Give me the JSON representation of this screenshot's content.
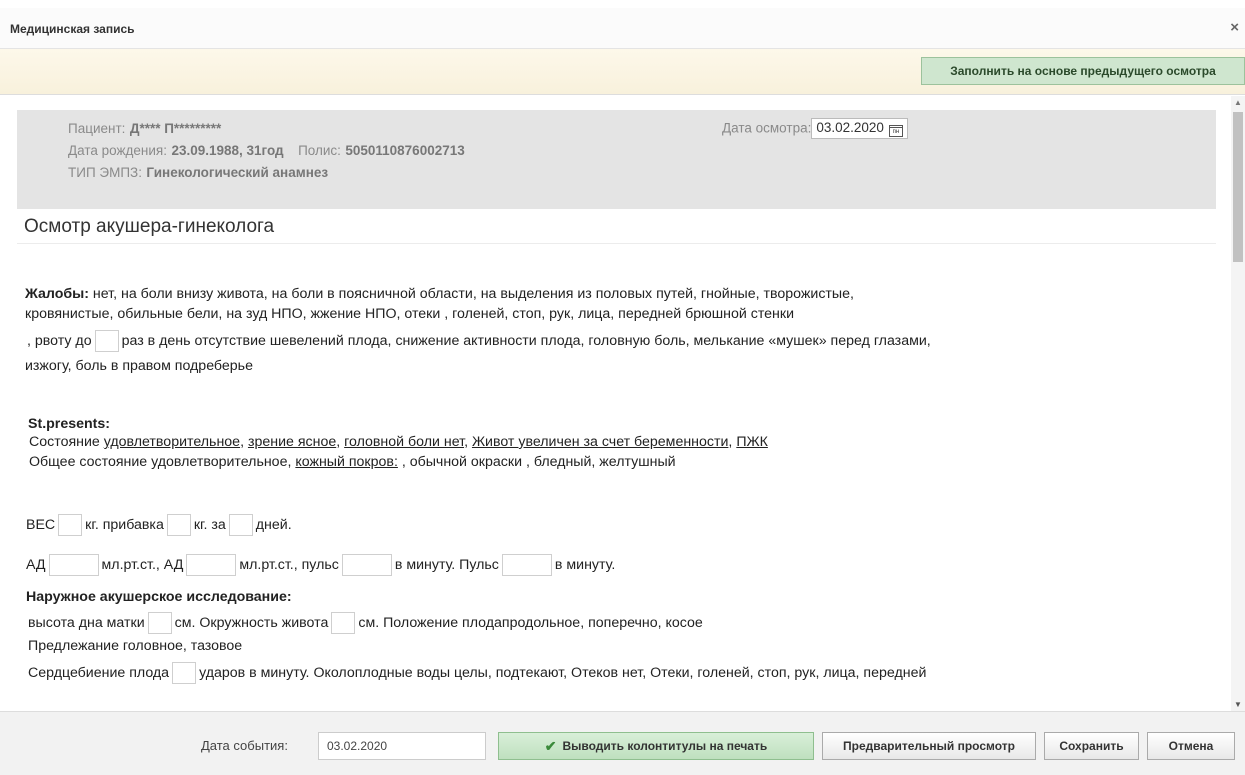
{
  "window": {
    "title": "Медицинская запись",
    "close_symbol": "×"
  },
  "toolbar": {
    "fill_button": "Заполнить на основе предыдущего осмотра"
  },
  "patient": {
    "patient_label": "Пациент:",
    "patient_name": "Д**** П*********",
    "birth_label": "Дата рождения:",
    "birth_value": "23.09.1988, 31год",
    "policy_label": "Полис:",
    "policy_value": "5050110876002713",
    "type_label": "ТИП ЭМПЗ:",
    "type_value": "Гинекологический анамнез",
    "exam_date_label": "Дата осмотра:",
    "exam_date_value": "03.02.2020",
    "calendar_icon_text": "пн"
  },
  "form": {
    "title": "Осмотр акушера-гинеколога",
    "complaints_label": "Жалобы:",
    "complaints_l1": " нет, на боли внизу живота, на боли в поясничной области, на выделения из половых путей, гнойные, творожистые,",
    "complaints_l2": "кровянистые, обильные бели, на зуд НПО, жжение НПО, отеки , голеней, стоп, рук, лица, передней брюшной стенки",
    "complaints_l3a": ", рвоту до",
    "complaints_l3b": "раз в день",
    "complaints_l3c": "отсутствие шевелений плода, снижение активности плода, головную боль, мелькание «мушек» перед глазами,",
    "complaints_l4": "изжогу, боль в правом подреберье",
    "st_label": "St.presents:",
    "st1_a": "Состояние ",
    "st1_b": "удовлетворительное",
    "st1_c": ", ",
    "st1_d": "зрение ясное",
    "st1_e": ", ",
    "st1_f": "головной боли нет",
    "st1_g": ", ",
    "st1_h": "Живот увеличен за счет беременности",
    "st1_i": ", ",
    "st1_j": "ПЖК",
    "st2_a": "Общее состояние удовлетворительное, ",
    "st2_b": "кожный покров:",
    "st2_c": " , обычной окраски , бледный, желтушный",
    "weight_a": "ВЕС",
    "weight_b": "кг. прибавка",
    "weight_c": "кг. за",
    "weight_d": "дней.",
    "bp_a": "АД",
    "bp_b": "мл.рт.ст., АД",
    "bp_c": "мл.рт.ст., пульс",
    "bp_d": "в минуту. Пульс",
    "bp_e": "в минуту.",
    "ext_label": "Наружное акушерское исследование:",
    "ext1_a": "высота дна матки",
    "ext1_b": "см. Окружность живота",
    "ext1_c": "см.",
    "ext1_d": "Положение плодапродольное, поперечно, косое",
    "ext2": "Предлежание головное, тазовое",
    "ext3_a": "Сердцебиение плода",
    "ext3_b": "ударов в минуту.",
    "ext3_c": "Околоплодные воды целы, подтекают, Отеков нет, Отеки, голеней, стоп, рук, лица, передней"
  },
  "footer": {
    "event_date_label": "Дата события:",
    "event_date_value": "03.02.2020",
    "print_button": "Выводить колонтитулы на печать",
    "preview_button": "Предварительный просмотр",
    "save_button": "Сохранить",
    "cancel_button": "Отмена"
  }
}
